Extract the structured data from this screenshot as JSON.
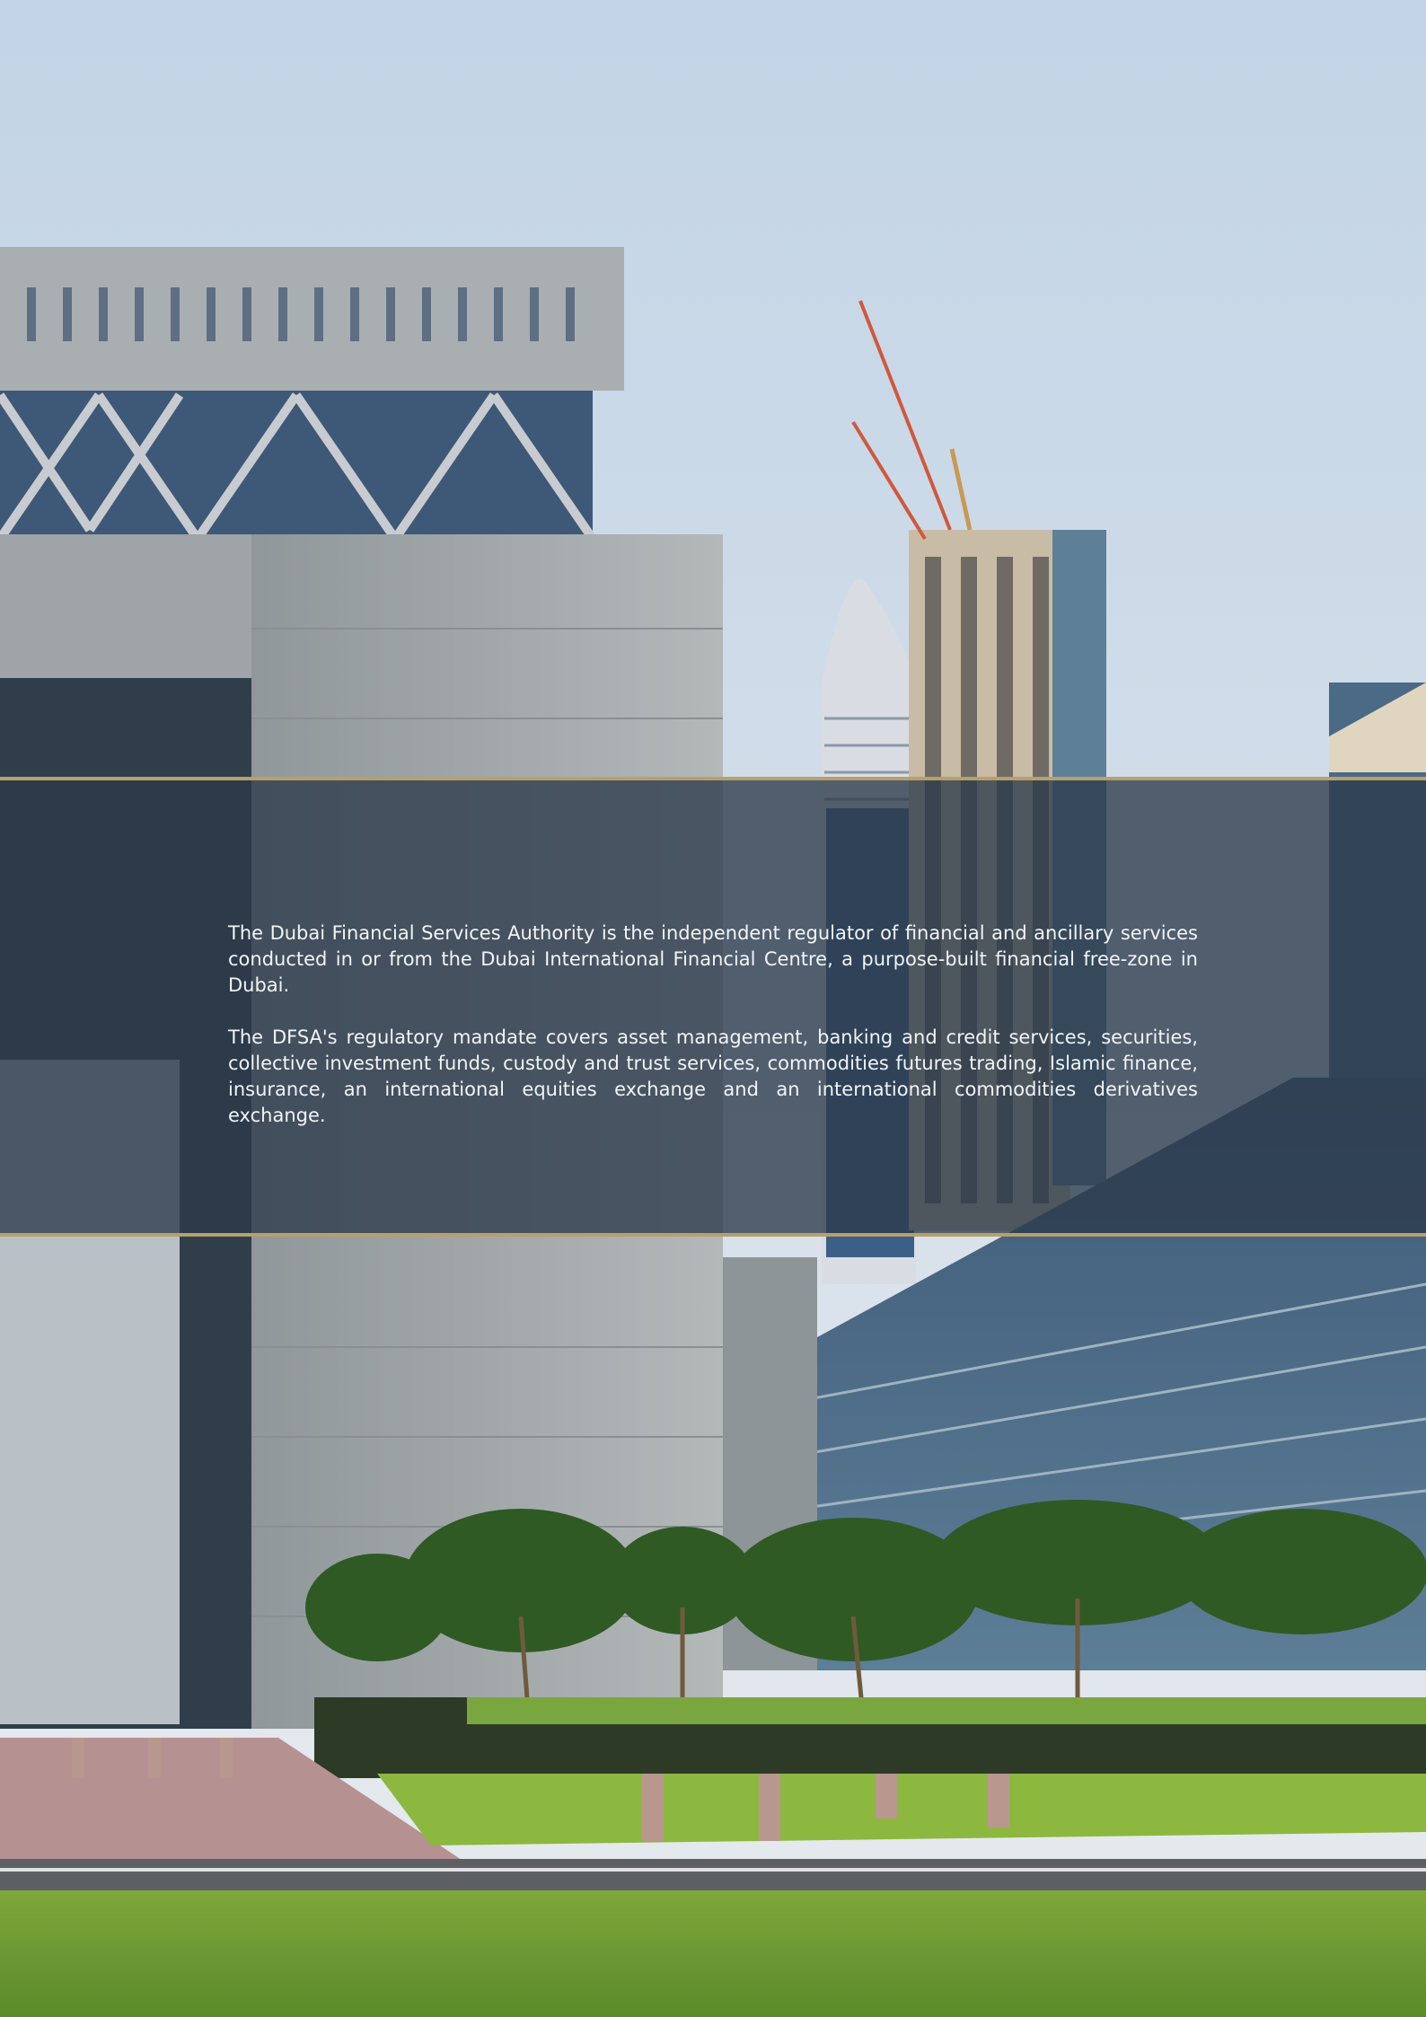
{
  "panel": {
    "paragraphs": [
      "The Dubai Financial Services Authority is the independent regulator of financial and ancillary services conducted in or from the Dubai International Financial Centre, a purpose-built financial free-zone in Dubai.",
      "The DFSA's regulatory mandate covers asset management, banking and credit services, securities, collective investment funds, custody and trust services, commodities futures trading, Islamic finance, insurance, an international equities exchange and an international commodities derivatives exchange."
    ]
  },
  "colors": {
    "sky_top": "#c5d6e6",
    "sky_bottom": "#e3e9ef",
    "band_overlay": "#2c3a4a",
    "gold_rule": "#b7a06a",
    "stone": "#9fa5a7",
    "glass": "#3f5e7e",
    "lawn": "#6d9a33"
  }
}
